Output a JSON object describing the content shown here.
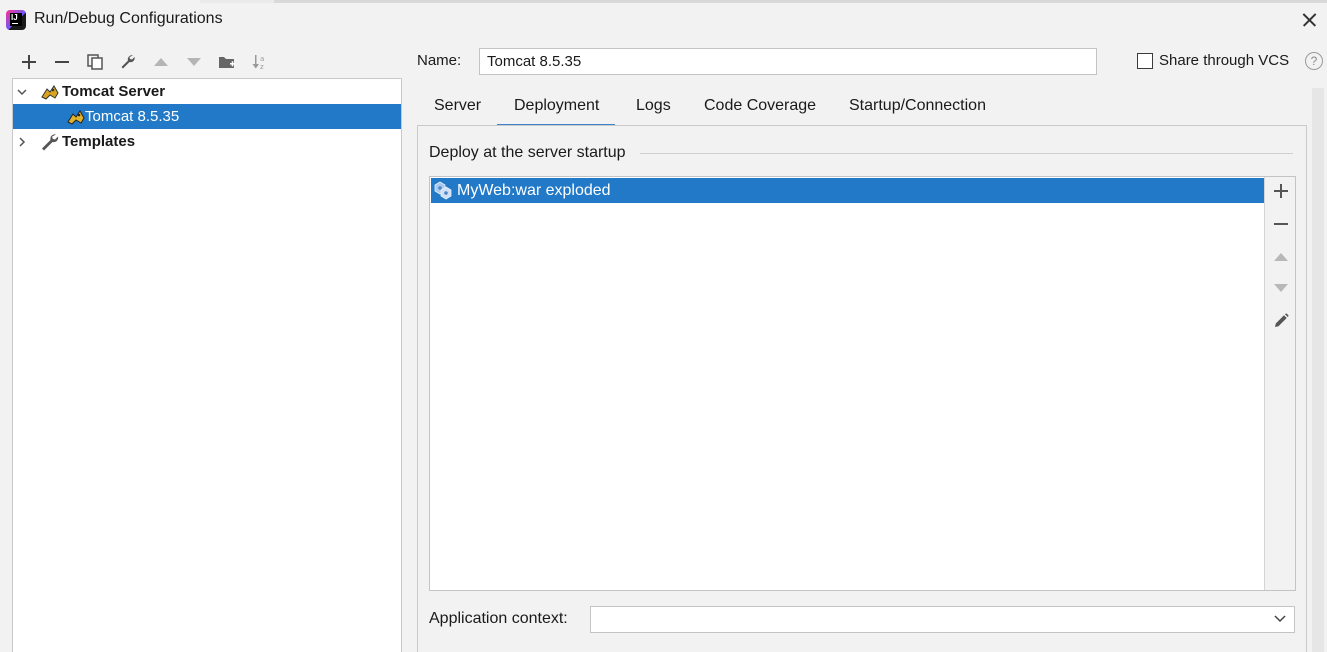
{
  "window": {
    "title": "Run/Debug Configurations",
    "app_icon": "intellij-idea-icon"
  },
  "toolbar": {
    "icons": [
      "add-icon",
      "remove-icon",
      "copy-icon",
      "wrench-icon",
      "move-up-icon",
      "move-down-icon",
      "new-folder-icon",
      "sort-icon"
    ]
  },
  "tree": {
    "group": {
      "label": "Tomcat Server",
      "expanded": true
    },
    "child": {
      "label": "Tomcat 8.5.35",
      "selected": true
    },
    "templates": {
      "label": "Templates",
      "expanded": false
    }
  },
  "form": {
    "name_label": "Name:",
    "name_value": "Tomcat 8.5.35",
    "share_label": "Share through VCS",
    "share_checked": false,
    "help": "?"
  },
  "tabs": [
    {
      "label": "Server",
      "active": false
    },
    {
      "label": "Deployment",
      "active": true
    },
    {
      "label": "Logs",
      "active": false
    },
    {
      "label": "Code Coverage",
      "active": false
    },
    {
      "label": "Startup/Connection",
      "active": false
    }
  ],
  "deployment": {
    "section_title": "Deploy at the server startup",
    "items": [
      {
        "label": "MyWeb:war exploded",
        "selected": true,
        "icon": "artifact-icon"
      }
    ],
    "side_tools": [
      "add-icon",
      "remove-icon",
      "move-up-icon",
      "move-down-icon",
      "edit-icon"
    ],
    "context_label": "Application context:",
    "context_value": ""
  },
  "colors": {
    "selection": "#2179c8",
    "tab_underline": "#4083c9",
    "background": "#f2f2f2"
  }
}
